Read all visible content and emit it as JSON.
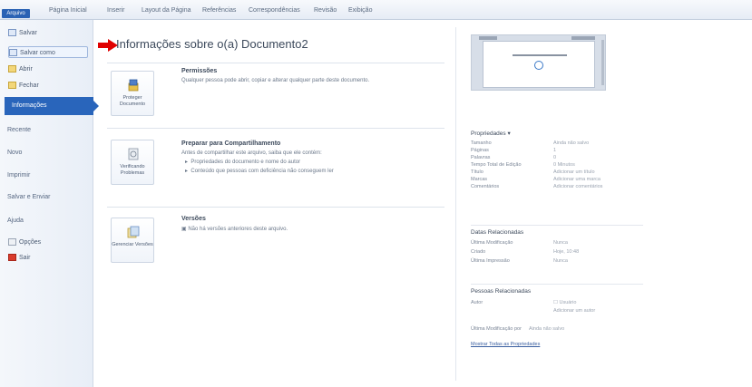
{
  "ribbon": {
    "tabs": [
      "Arquivo",
      "Página Inicial",
      "Inserir",
      "Layout da Página",
      "Referências",
      "Correspondências",
      "Revisão",
      "Exibição"
    ]
  },
  "sidebar": {
    "items": [
      "Salvar",
      "Salvar como",
      "Abrir",
      "Fechar"
    ],
    "active": "Informações",
    "big_items": [
      "Recente",
      "Novo",
      "Imprimir",
      "Salvar e Enviar",
      "Ajuda"
    ],
    "bottom_items": [
      "Opções",
      "Sair"
    ]
  },
  "main": {
    "title": "Informações sobre o(a) Documento2",
    "permissions": {
      "button": "Proteger Documento",
      "title": "Permissões",
      "text": "Qualquer pessoa pode abrir, copiar e alterar qualquer parte deste documento."
    },
    "share": {
      "button": "Verificando Problemas",
      "title": "Preparar para Compartilhamento",
      "text": "Antes de compartilhar este arquivo, saiba que ele contém:",
      "bullets": [
        "Propriedades do documento e nome do autor",
        "Conteúdo que pessoas com deficiência não conseguem ler"
      ]
    },
    "versions": {
      "button": "Gerenciar Versões",
      "title": "Versões",
      "text": "Não há versões anteriores deste arquivo."
    }
  },
  "right": {
    "properties_title": "Propriedades",
    "properties": [
      {
        "k": "Tamanho",
        "v": "Ainda não salvo"
      },
      {
        "k": "Páginas",
        "v": "1"
      },
      {
        "k": "Palavras",
        "v": "0"
      },
      {
        "k": "Tempo Total de Edição",
        "v": "0 Minutos"
      },
      {
        "k": "Título",
        "v": "Adicionar um título"
      },
      {
        "k": "Marcas",
        "v": "Adicionar uma marca"
      },
      {
        "k": "Comentários",
        "v": "Adicionar comentários"
      }
    ],
    "dates_title": "Datas Relacionadas",
    "dates": [
      {
        "k": "Última Modificação",
        "v": "Nunca"
      },
      {
        "k": "Criado",
        "v": "Hoje, 10:48"
      },
      {
        "k": "Última Impressão",
        "v": "Nunca"
      }
    ],
    "people_title": "Pessoas Relacionadas",
    "author_key": "Autor",
    "author_value": "Usuário",
    "add_author": "Adicionar um autor",
    "last_modified_by_key": "Última Modificação por",
    "last_modified_by_val": "Ainda não salvo",
    "show_all": "Mostrar Todas as Propriedades"
  }
}
